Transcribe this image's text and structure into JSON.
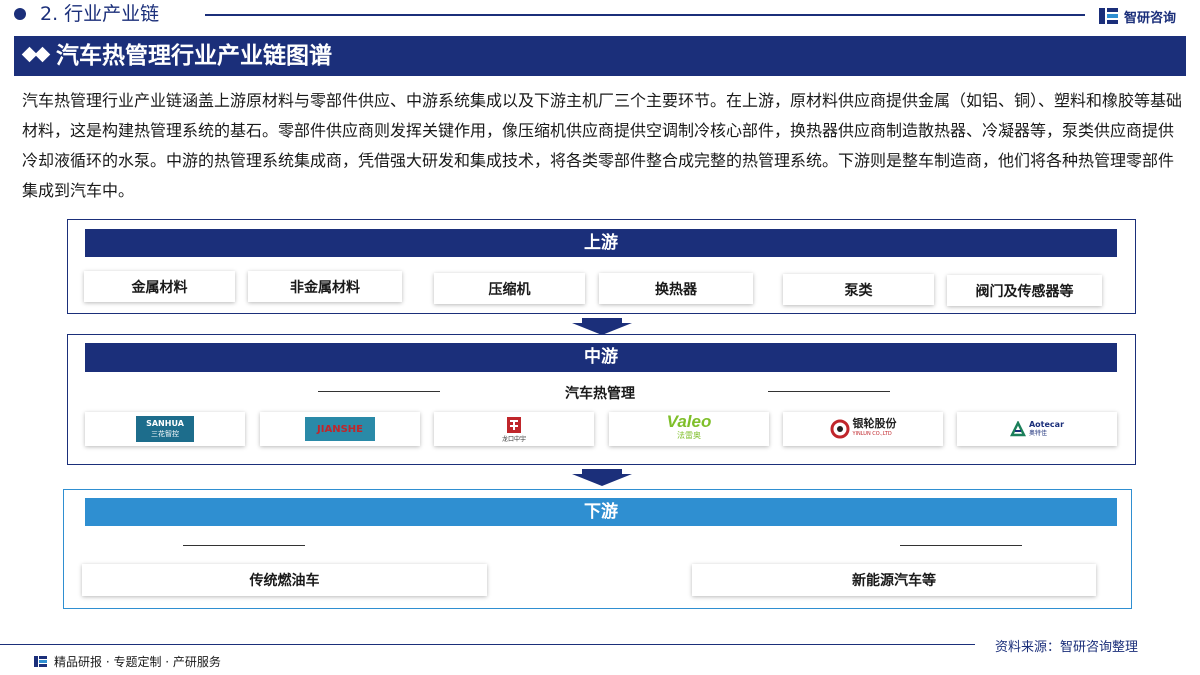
{
  "header": {
    "section_title": "2. 行业产业链",
    "logo_text": "智研咨询",
    "main_title": "汽车热管理行业产业链图谱"
  },
  "intro": "汽车热管理行业产业链涵盖上游原材料与零部件供应、中游系统集成以及下游主机厂三个主要环节。在上游，原材料供应商提供金属（如铝、铜）、塑料和橡胶等基础材料，这是构建热管理系统的基石。零部件供应商则发挥关键作用，像压缩机供应商提供空调制冷核心部件，换热器供应商制造散热器、冷凝器等，泵类供应商提供冷却液循环的水泵。中游的热管理系统集成商，凭借强大研发和集成技术，将各类零部件整合成完整的热管理系统。下游则是整车制造商，他们将各种热管理零部件集成到汽车中。",
  "upstream": {
    "label": "上游",
    "items": [
      "金属材料",
      "非金属材料",
      "压缩机",
      "换热器",
      "泵类",
      "阀门及传感器等"
    ]
  },
  "midstream": {
    "label": "中游",
    "sublabel": "汽车热管理",
    "logos": [
      {
        "name": "SANHUA",
        "sub": "三花智控"
      },
      {
        "name": "JIANSHE",
        "sub": ""
      },
      {
        "name": "龙口中宇",
        "sub": ""
      },
      {
        "name": "Valeo",
        "sub": "法雷奥"
      },
      {
        "name": "银轮股份",
        "sub": "YINLUN CO.,LTD"
      },
      {
        "name": "Aotecar",
        "sub": "奥特佳"
      }
    ]
  },
  "downstream": {
    "label": "下游",
    "items": [
      "传统燃油车",
      "新能源汽车等"
    ]
  },
  "footer": {
    "left": "精品研报 · 专题定制 · 产研服务",
    "source": "资料来源：智研咨询整理"
  },
  "colors": {
    "navy": "#1b2f7a",
    "light_blue": "#2f8fd1"
  }
}
